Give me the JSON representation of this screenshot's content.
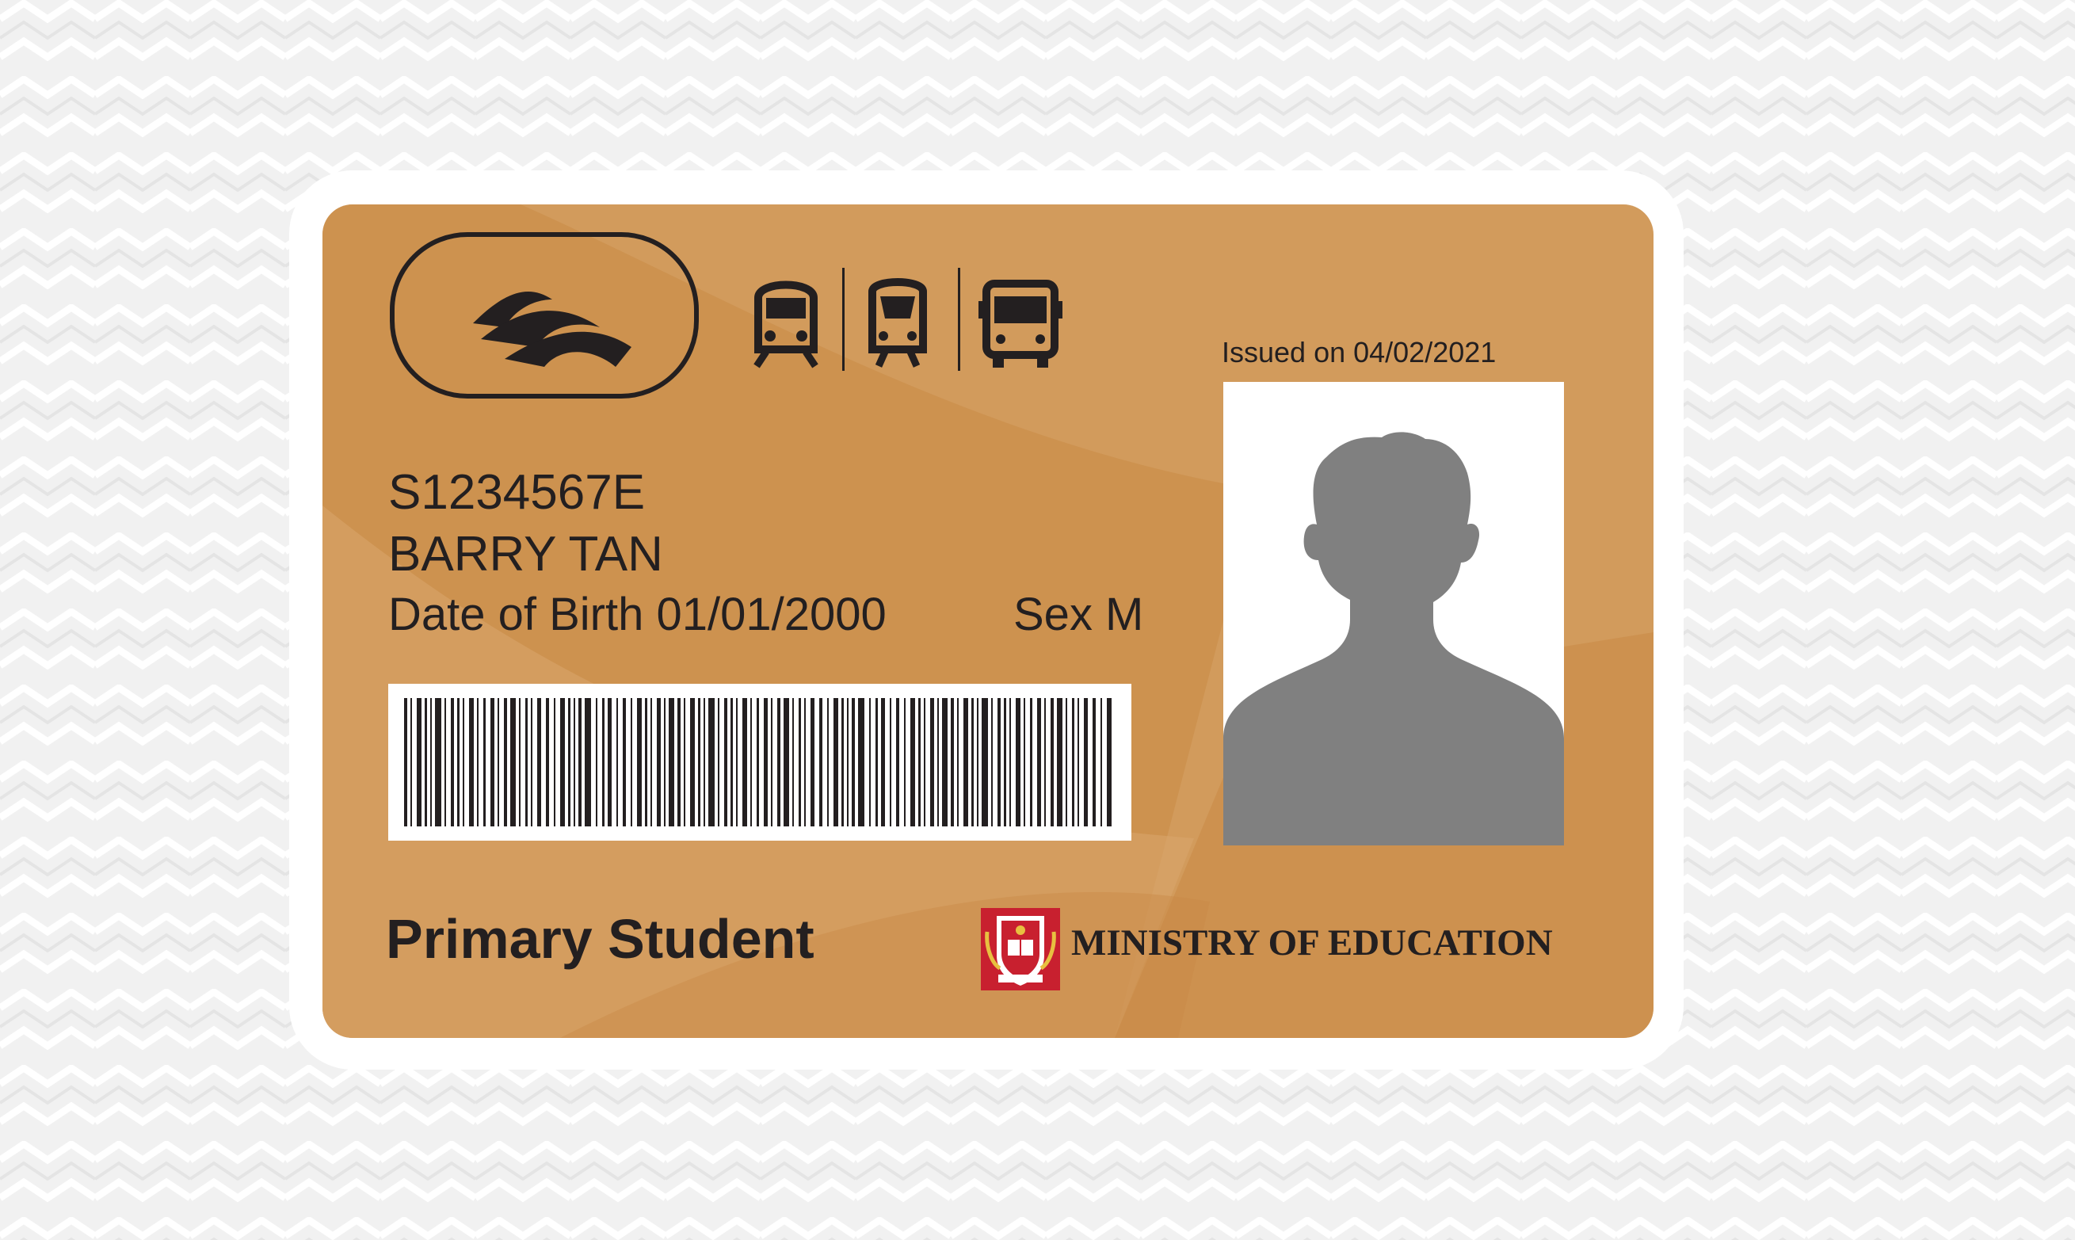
{
  "card": {
    "id_number": "S1234567E",
    "holder_name": "BARRY TAN",
    "date_of_birth": "Date of Birth 01/01/2000",
    "sex": "Sex M",
    "issued": "Issued on 04/02/2021",
    "category": "Primary Student",
    "issuer": "MINISTRY OF EDUCATION"
  },
  "icons": [
    "transit-logo-icon",
    "mrt-train-icon",
    "lrt-train-icon",
    "bus-icon",
    "moe-crest-icon",
    "person-silhouette-icon"
  ],
  "colors": {
    "card": "#d29b5c",
    "card_band": "#c98a46",
    "frame": "#ffffff",
    "background": "#f1f1f1",
    "ink": "#231f20",
    "silhouette": "#808080",
    "crest_red": "#c8202f"
  }
}
